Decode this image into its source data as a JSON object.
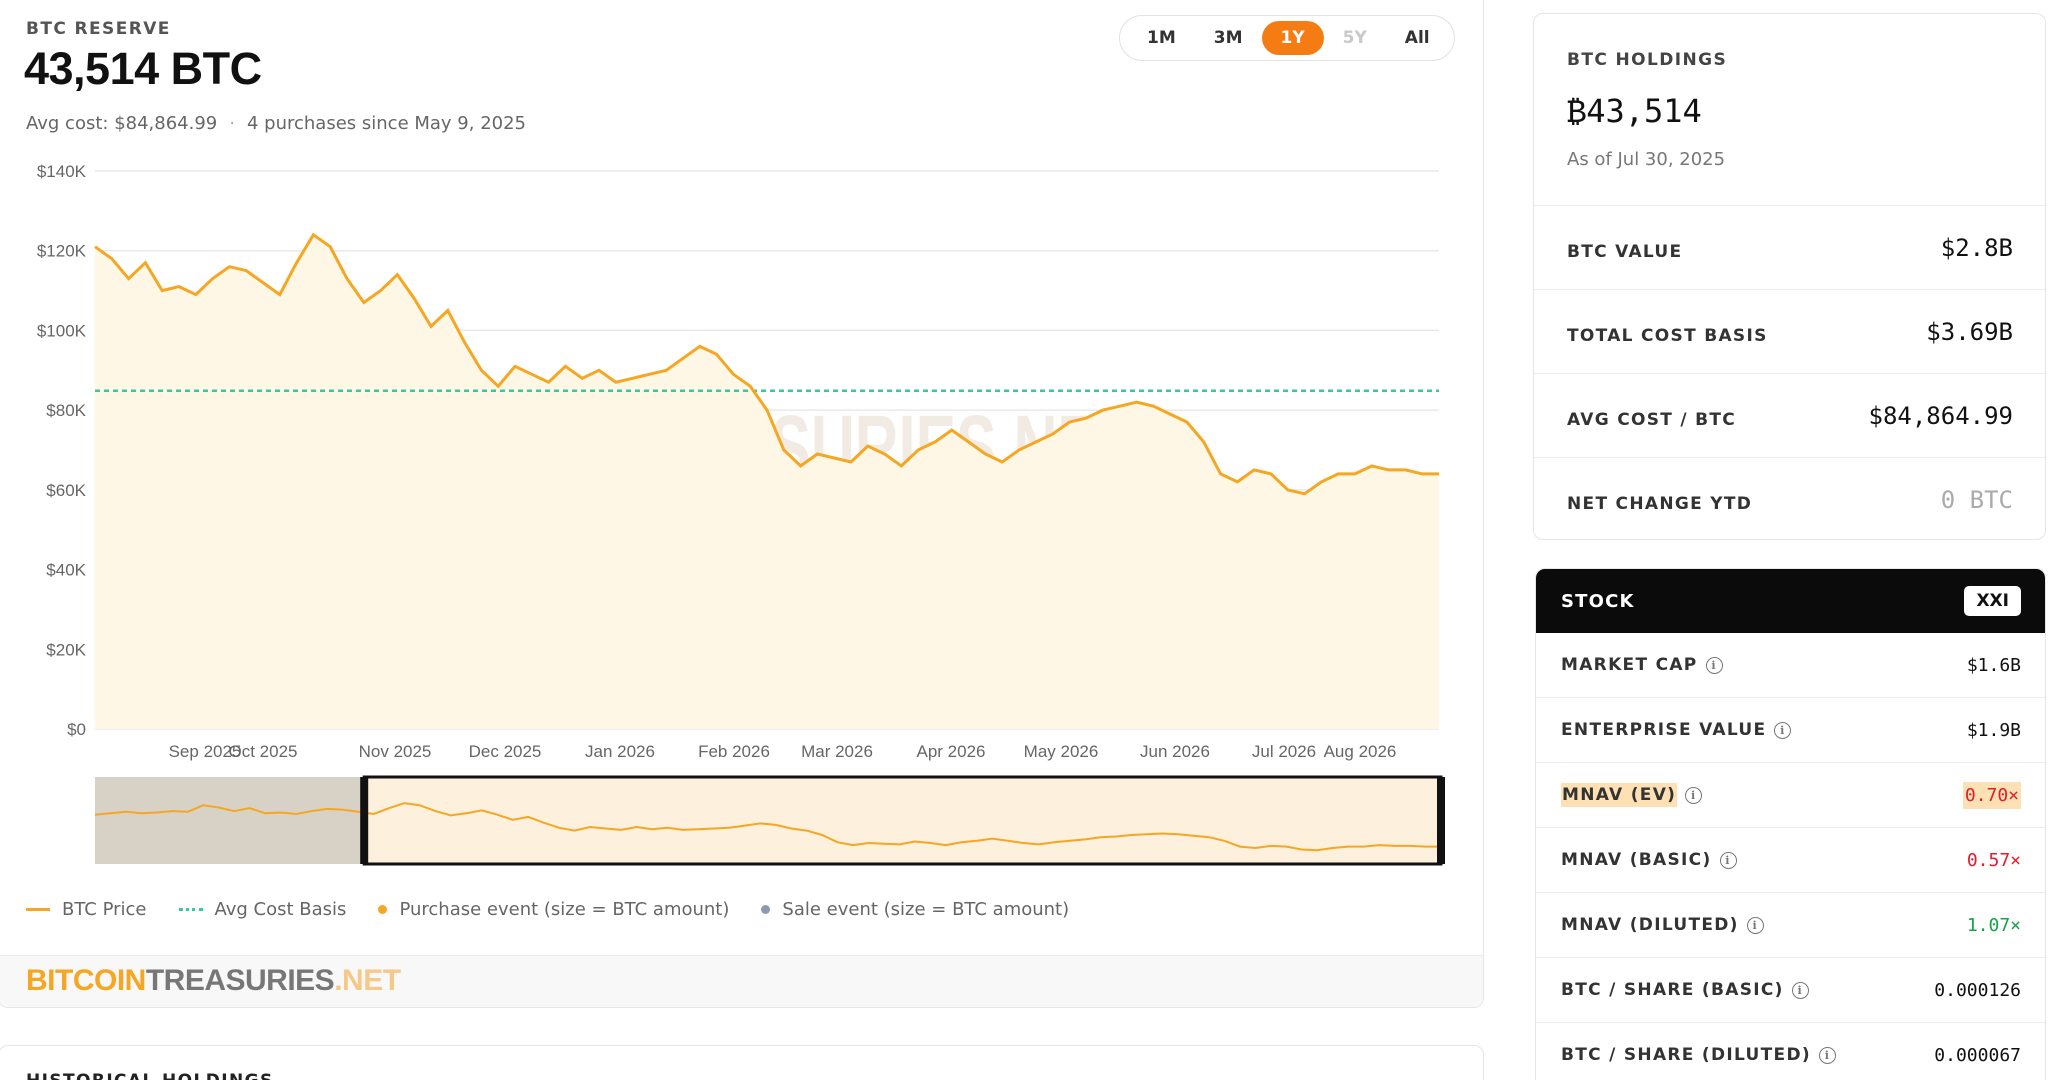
{
  "reserve": {
    "label": "BTC RESERVE",
    "value": "43,514 BTC",
    "avg_cost": "Avg cost: $84,864.99",
    "purchases": "4 purchases since May 9, 2025"
  },
  "ranges": [
    {
      "label": "1M",
      "state": "normal"
    },
    {
      "label": "3M",
      "state": "normal"
    },
    {
      "label": "1Y",
      "state": "active"
    },
    {
      "label": "5Y",
      "state": "disabled"
    },
    {
      "label": "All",
      "state": "normal"
    }
  ],
  "watermark": "BITCOINTREASURIES.NET",
  "chart_data": {
    "type": "area",
    "title": "",
    "y_ticks": [
      "$140K",
      "$120K",
      "$100K",
      "$80K",
      "$60K",
      "$40K",
      "$20K",
      "$0"
    ],
    "ylim": [
      0,
      140000
    ],
    "x_ticks": [
      "Sep 2025",
      "Oct 2025",
      "Nov 2025",
      "Dec 2025",
      "Jan 2026",
      "Feb 2026",
      "Mar 2026",
      "Apr 2026",
      "May 2026",
      "Jun 2026",
      "Jul 2026",
      "Aug 2026"
    ],
    "avg_cost_basis": 84865,
    "series": [
      {
        "name": "BTC Price",
        "color": "#f5a623",
        "x_range": [
          "Aug 2025",
          "Aug 2026"
        ],
        "values": [
          121000,
          118000,
          113000,
          117000,
          110000,
          111000,
          109000,
          113000,
          116000,
          115000,
          112000,
          109000,
          117000,
          124000,
          121000,
          113000,
          107000,
          110000,
          114000,
          108000,
          101000,
          105000,
          97000,
          90000,
          86000,
          91000,
          89000,
          87000,
          91000,
          88000,
          90000,
          87000,
          88000,
          89000,
          90000,
          93000,
          96000,
          94000,
          89000,
          86000,
          80000,
          70000,
          66000,
          69000,
          68000,
          67000,
          71000,
          69000,
          66000,
          70000,
          72000,
          75000,
          72000,
          69000,
          67000,
          70000,
          72000,
          74000,
          77000,
          78000,
          80000,
          81000,
          82000,
          81000,
          79000,
          77000,
          72000,
          64000,
          62000,
          65000,
          64000,
          60000,
          59000,
          62000,
          64000,
          64000,
          66000,
          65000,
          65000,
          64000,
          64000
        ]
      }
    ],
    "navigator_selection": [
      0.2,
      1.0
    ],
    "legend": [
      {
        "label": "BTC Price",
        "kind": "line",
        "color": "#f5a623"
      },
      {
        "label": "Avg Cost Basis",
        "kind": "dash",
        "color": "#36c9a0"
      },
      {
        "label": "Purchase event (size = BTC amount)",
        "kind": "dot",
        "color": "#f5a623"
      },
      {
        "label": "Sale event (size = BTC amount)",
        "kind": "dot",
        "color": "#8a9bb0"
      }
    ]
  },
  "footer_brand": {
    "part1": "BITCOIN",
    "part2": "TREASURIES",
    "part3": ".NET"
  },
  "historical": {
    "title": "HISTORICAL HOLDINGS"
  },
  "holdings": {
    "label": "BTC HOLDINGS",
    "value": "₿43,514",
    "as_of": "As of Jul 30, 2025",
    "rows": [
      {
        "key": "BTC VALUE",
        "value": "$2.8B"
      },
      {
        "key": "TOTAL COST BASIS",
        "value": "$3.69B"
      },
      {
        "key": "AVG COST / BTC",
        "value": "$84,864.99"
      },
      {
        "key": "NET CHANGE YTD",
        "value": "0 BTC"
      }
    ]
  },
  "stock": {
    "title": "STOCK",
    "ticker": "XXI",
    "rows": [
      {
        "key": "MARKET CAP",
        "value": "$1.6B",
        "tone": "normal"
      },
      {
        "key": "ENTERPRISE VALUE",
        "value": "$1.9B",
        "tone": "normal"
      },
      {
        "key": "MNAV (EV)",
        "value": "0.70×",
        "tone": "neg"
      },
      {
        "key": "MNAV (BASIC)",
        "value": "0.57×",
        "tone": "neg"
      },
      {
        "key": "MNAV (DILUTED)",
        "value": "1.07×",
        "tone": "pos"
      },
      {
        "key": "BTC / SHARE (BASIC)",
        "value": "0.000126",
        "tone": "normal"
      },
      {
        "key": "BTC / SHARE (DILUTED)",
        "value": "0.000067",
        "tone": "normal"
      }
    ]
  }
}
